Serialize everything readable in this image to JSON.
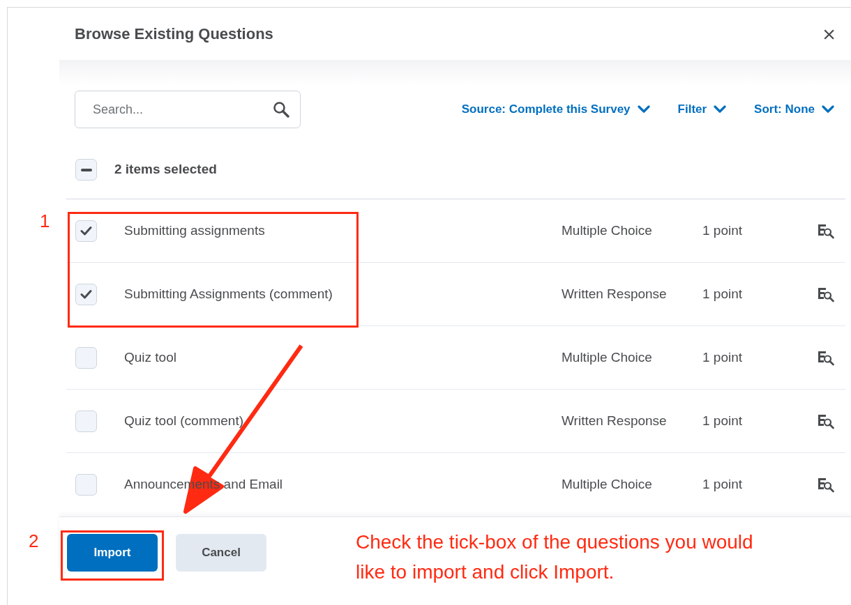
{
  "dialog": {
    "title": "Browse Existing Questions",
    "close": "×"
  },
  "search": {
    "placeholder": "Search..."
  },
  "dropdowns": [
    {
      "label": "Source: Complete this Survey"
    },
    {
      "label": "Filter"
    },
    {
      "label": "Sort: None"
    }
  ],
  "select_all": {
    "label": "2 items selected",
    "indeterminate": true
  },
  "questions": [
    {
      "title": "Submitting assignments",
      "type": "Multiple Choice",
      "points": "1 point",
      "checked": true
    },
    {
      "title": "Submitting Assignments (comment)",
      "type": "Written Response",
      "points": "1 point",
      "checked": true
    },
    {
      "title": "Quiz tool",
      "type": "Multiple Choice",
      "points": "1 point",
      "checked": false
    },
    {
      "title": "Quiz tool (comment)",
      "type": "Written Response",
      "points": "1 point",
      "checked": false
    },
    {
      "title": "Announcements and Email",
      "type": "Multiple Choice",
      "points": "1 point",
      "checked": false
    }
  ],
  "buttons": [
    {
      "label": "Import",
      "kind": "primary"
    },
    {
      "label": "Cancel",
      "kind": "secondary"
    }
  ],
  "annotations": {
    "step_labels": [
      "1",
      "2"
    ],
    "instruction": "Check the tick-box of the questions you would like to import and click Import."
  }
}
